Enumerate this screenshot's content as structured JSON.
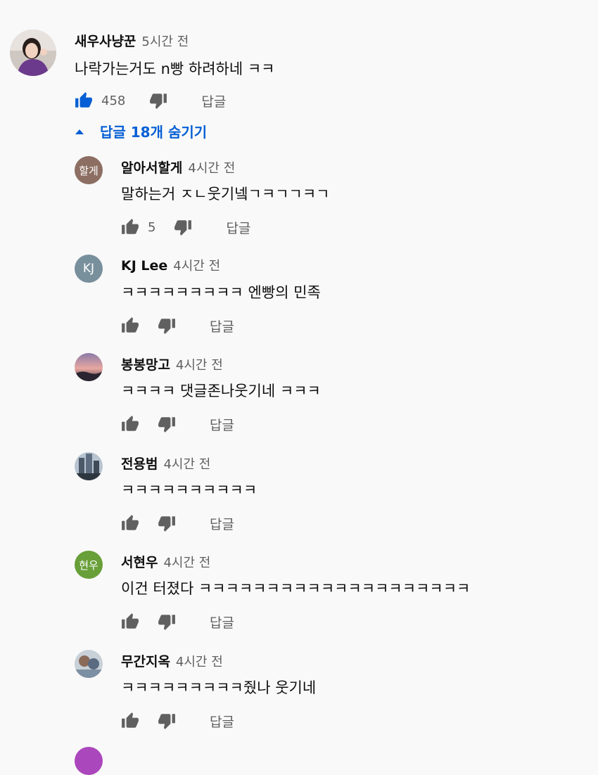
{
  "main_comment": {
    "author": "새우사냥꾼",
    "time": "5시간 전",
    "text": "나락가는거도 n빵 하려하네 ㅋㅋ",
    "likes": "458",
    "reply_label": "답글"
  },
  "replies_toggle": {
    "label": "답글 18개 숨기기",
    "accent": "#065fd4"
  },
  "replies": [
    {
      "author": "알아서할게",
      "time": "4시간 전",
      "text": "말하는거 ㅈㄴ웃기넼ㄱㅋㄱㄱㅋㄱ",
      "likes": "5",
      "reply_label": "답글",
      "avatar_text": "할게",
      "avatar_color": "#8d6e63"
    },
    {
      "author": "KJ Lee",
      "time": "4시간 전",
      "text": "ㅋㅋㅋㅋㅋㅋㅋㅋㅋ 엔빵의 민족",
      "likes": "",
      "reply_label": "답글",
      "avatar_text": "KJ",
      "avatar_color": "#78909c"
    },
    {
      "author": "봉봉망고",
      "time": "4시간 전",
      "text": "ㅋㅋㅋㅋ 댓글존나웃기네 ㅋㅋㅋ",
      "likes": "",
      "reply_label": "답글",
      "avatar_text": "",
      "avatar_color": "#c9a2a8"
    },
    {
      "author": "전용범",
      "time": "4시간 전",
      "text": "ㅋㅋㅋㅋㅋㅋㅋㅋㅋㅋ",
      "likes": "",
      "reply_label": "답글",
      "avatar_text": "",
      "avatar_color": "#7a8a9a"
    },
    {
      "author": "서현우",
      "time": "4시간 전",
      "text": "이건 터졌다 ㅋㅋㅋㅋㅋㅋㅋㅋㅋㅋㅋㅋㅋㅋㅋㅋㅋㅋㅋㅋ",
      "likes": "",
      "reply_label": "답글",
      "avatar_text": "현우",
      "avatar_color": "#689f38"
    },
    {
      "author": "무간지옥",
      "time": "4시간 전",
      "text": "ㅋㅋㅋㅋㅋㅋㅋㅋㅋ줬나 웃기네",
      "likes": "",
      "reply_label": "답글",
      "avatar_text": "",
      "avatar_color": "#b0bec5"
    }
  ],
  "icons": {
    "like": "thumb-up-icon",
    "dislike": "thumb-down-icon",
    "collapse": "caret-up-icon"
  }
}
